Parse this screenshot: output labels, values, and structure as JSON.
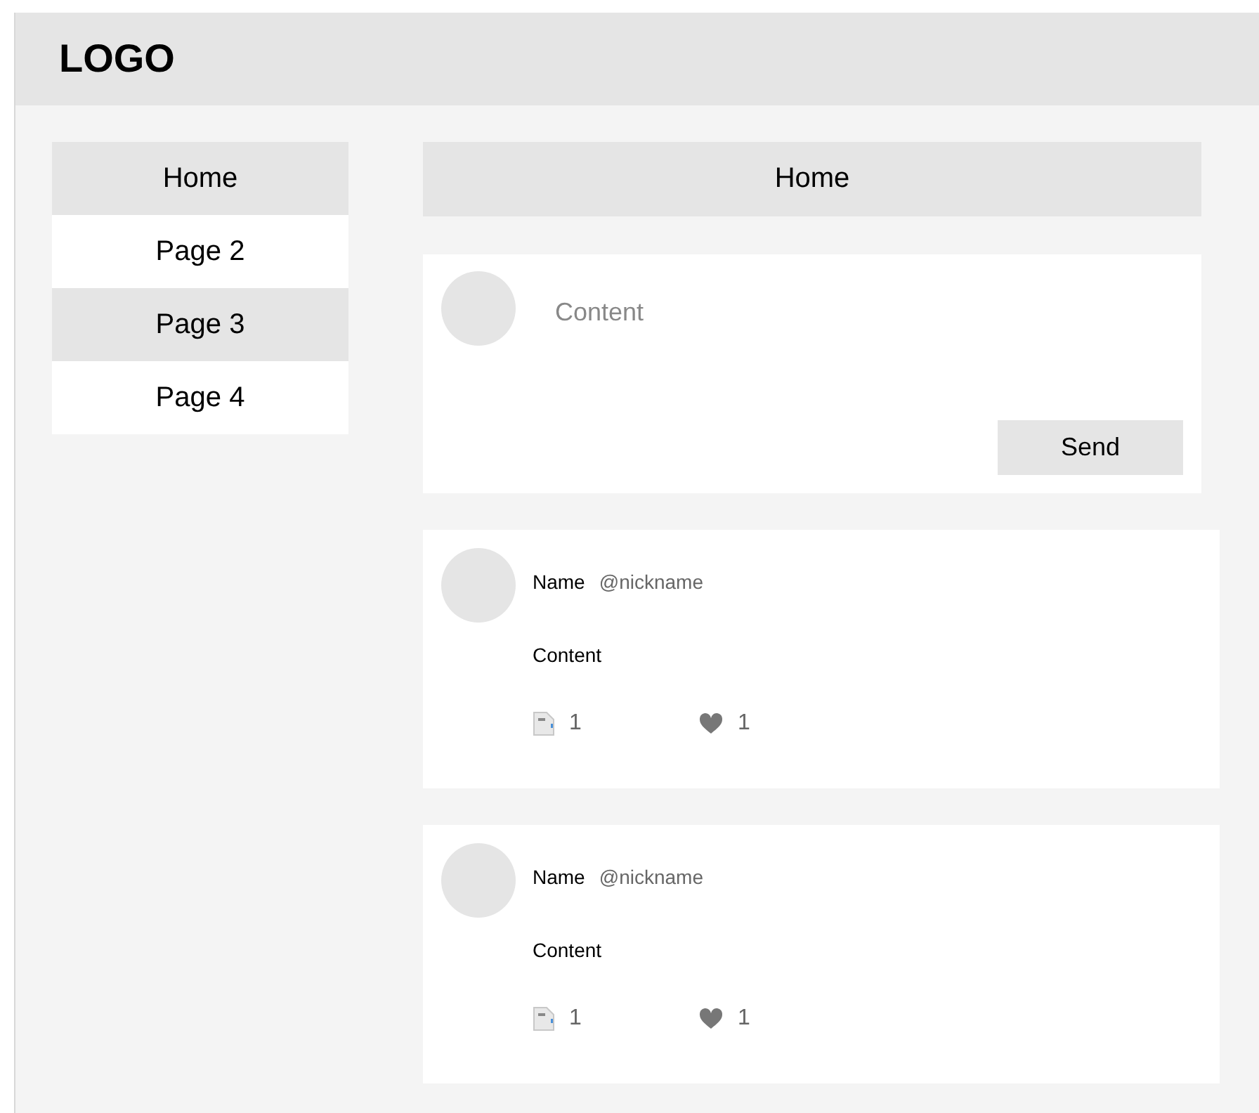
{
  "header": {
    "logo": "LOGO"
  },
  "sidebar": {
    "items": [
      {
        "label": "Home"
      },
      {
        "label": "Page 2"
      },
      {
        "label": "Page 3"
      },
      {
        "label": "Page 4"
      }
    ]
  },
  "main": {
    "title": "Home",
    "composer": {
      "placeholder": "Content",
      "button": "Send"
    },
    "posts": [
      {
        "name": "Name",
        "nickname": "@nickname",
        "content": "Content",
        "replies": "1",
        "likes": "1"
      },
      {
        "name": "Name",
        "nickname": "@nickname",
        "content": "Content",
        "replies": "1",
        "likes": "1"
      }
    ]
  }
}
